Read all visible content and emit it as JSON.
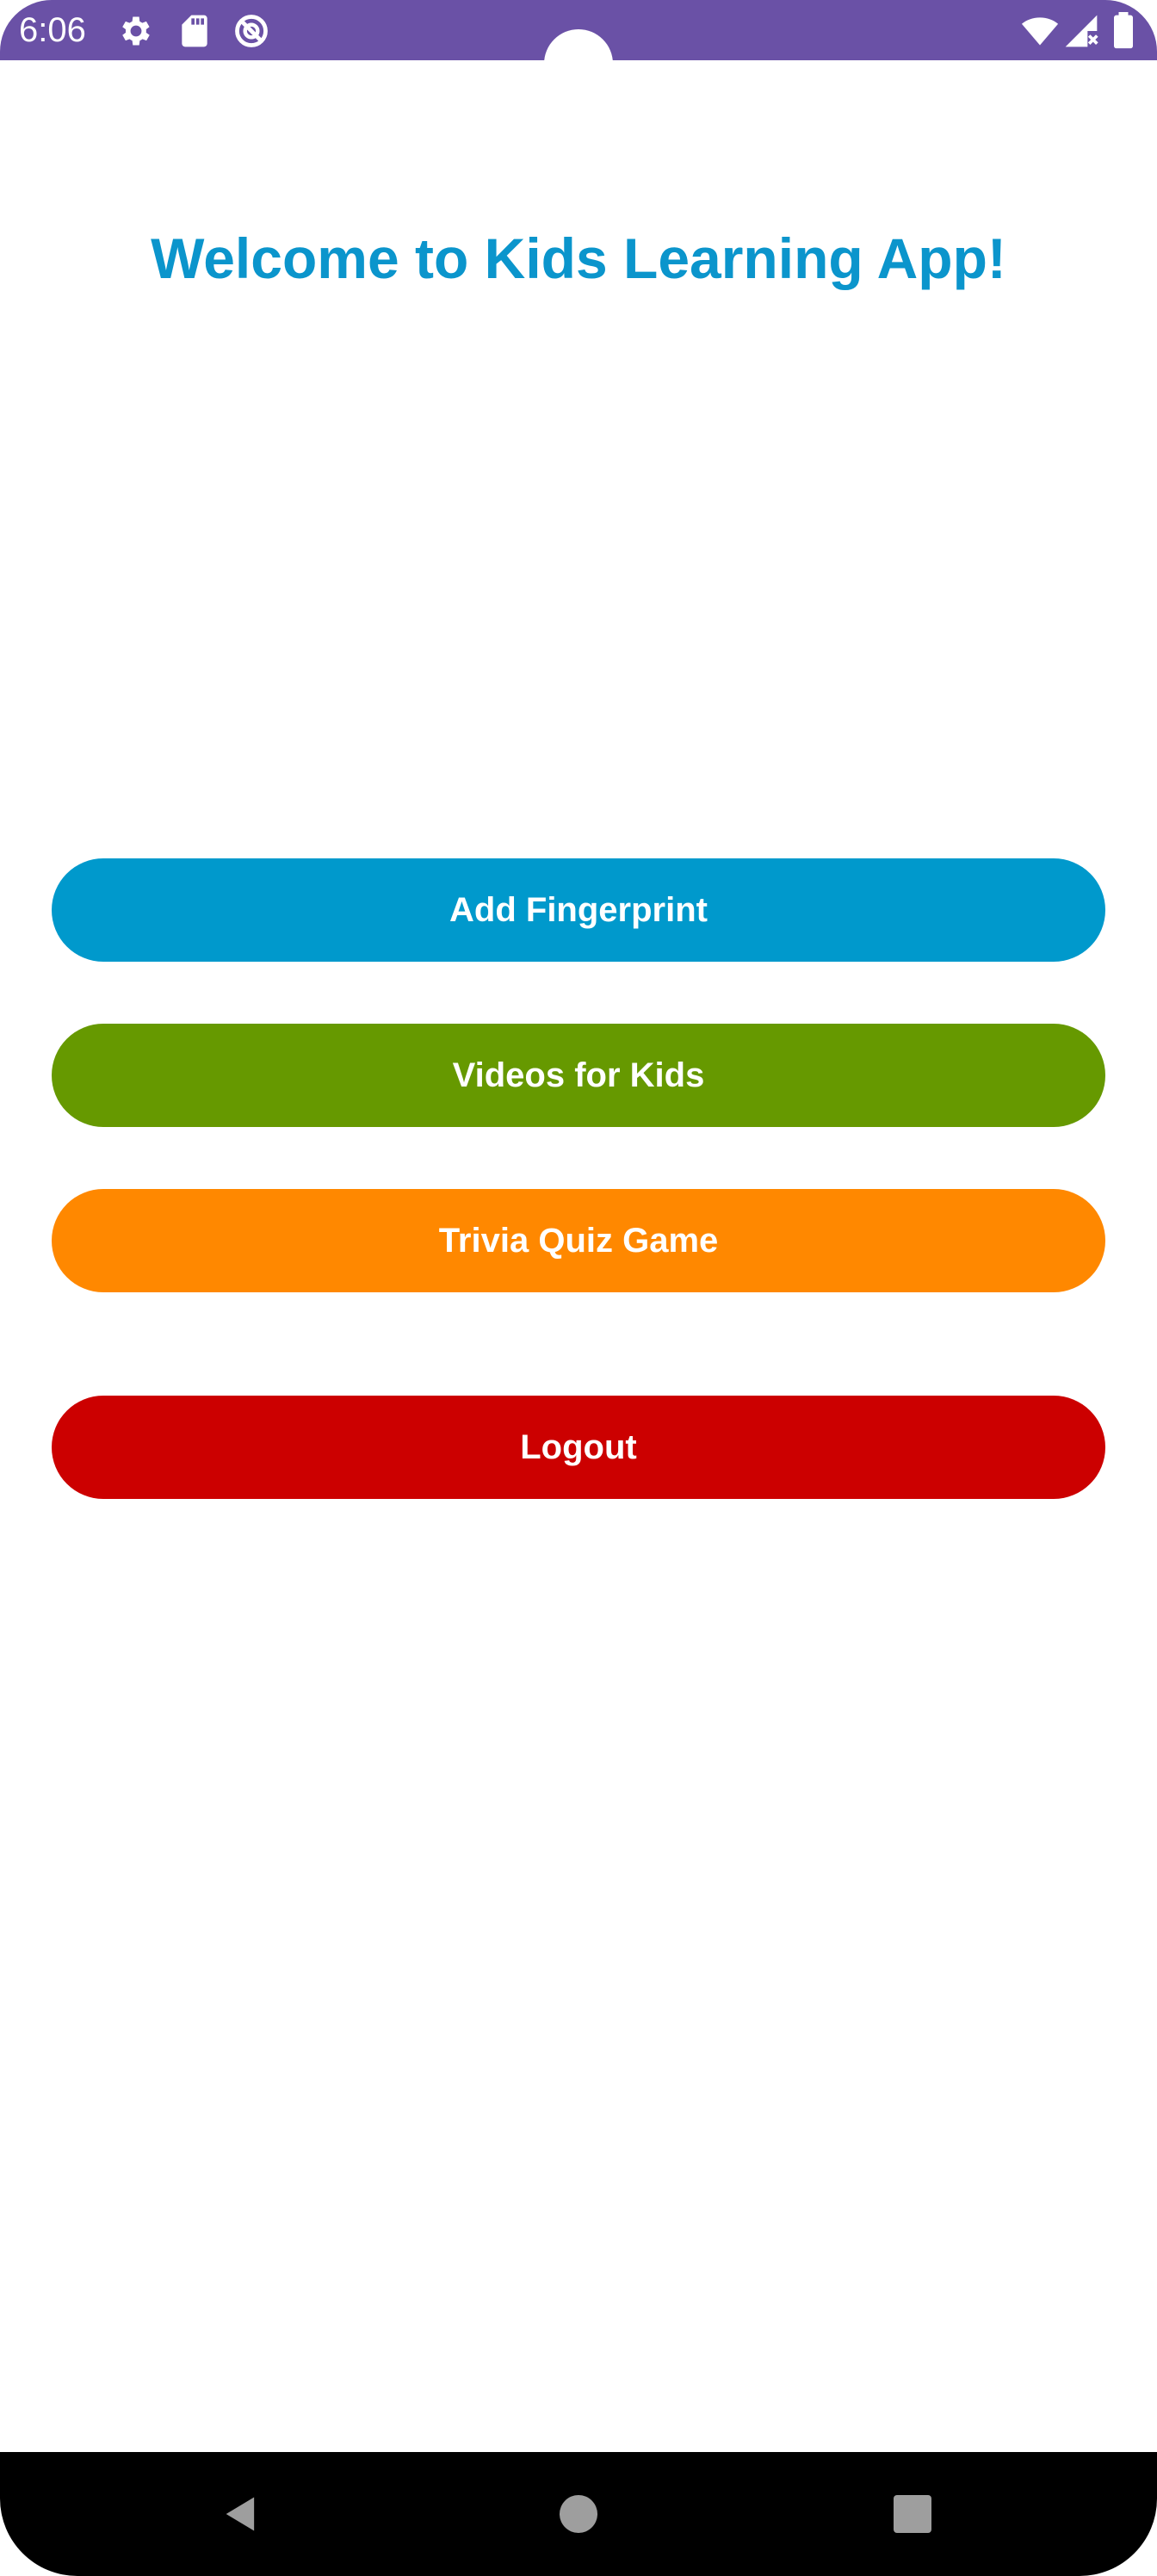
{
  "status_bar": {
    "time": "6:06",
    "color": "#6a51a6",
    "icons": [
      "settings-icon",
      "sd-card-icon",
      "do-not-disturb-icon",
      "wifi-icon",
      "signal-icon",
      "battery-icon"
    ]
  },
  "main": {
    "title": "Welcome to Kids Learning App!",
    "title_color": "#0b95cc"
  },
  "buttons": {
    "add_fingerprint": {
      "label": "Add Fingerprint",
      "color": "#0099cc"
    },
    "videos_for_kids": {
      "label": "Videos for Kids",
      "color": "#669900"
    },
    "trivia_quiz_game": {
      "label": "Trivia Quiz Game",
      "color": "#ff8800"
    },
    "logout": {
      "label": "Logout",
      "color": "#cc0000"
    }
  },
  "nav_bar": {
    "icons": [
      "back-icon",
      "home-icon",
      "recents-icon"
    ]
  }
}
